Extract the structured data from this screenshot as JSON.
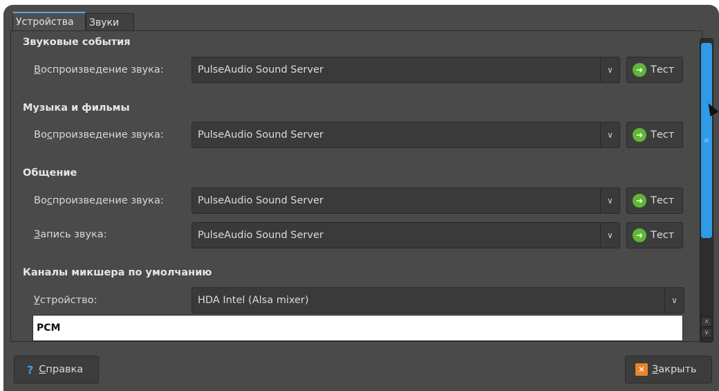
{
  "tabs": [
    {
      "label": "Устройства",
      "active": true
    },
    {
      "label": "Звуки",
      "active": false
    }
  ],
  "sections": {
    "sound_events": {
      "title": "Звуковые события",
      "label_first": "В",
      "label_rest": "оспроизведение звука:",
      "value": "PulseAudio Sound Server",
      "test": "Тест"
    },
    "music_movies": {
      "title": "Музыка и фильмы",
      "label_first": "Во",
      "label_ul": "с",
      "label_rest": "произведение звука:",
      "value": "PulseAudio Sound Server",
      "test": "Тест"
    },
    "communication": {
      "title": "Общение",
      "playback_first": "Во",
      "playback_ul": "с",
      "playback_rest": "произведение звука:",
      "playback_value": "PulseAudio Sound Server",
      "playback_test": "Тест",
      "record_ul": "З",
      "record_rest": "апись звука:",
      "record_value": "PulseAudio Sound Server",
      "record_test": "Тест"
    },
    "mixer": {
      "title": "Каналы микшера по умолчанию",
      "device_ul": "У",
      "device_rest": "стройство:",
      "device_value": "HDA Intel (Alsa mixer)",
      "channel": "PCM"
    }
  },
  "footer": {
    "help_ul": "С",
    "help_rest": "правка",
    "close_ul": "З",
    "close_rest": "акрыть"
  },
  "colors": {
    "accent": "#2e9be6",
    "test_icon": "#5fb735",
    "close_icon": "#e8862a"
  }
}
